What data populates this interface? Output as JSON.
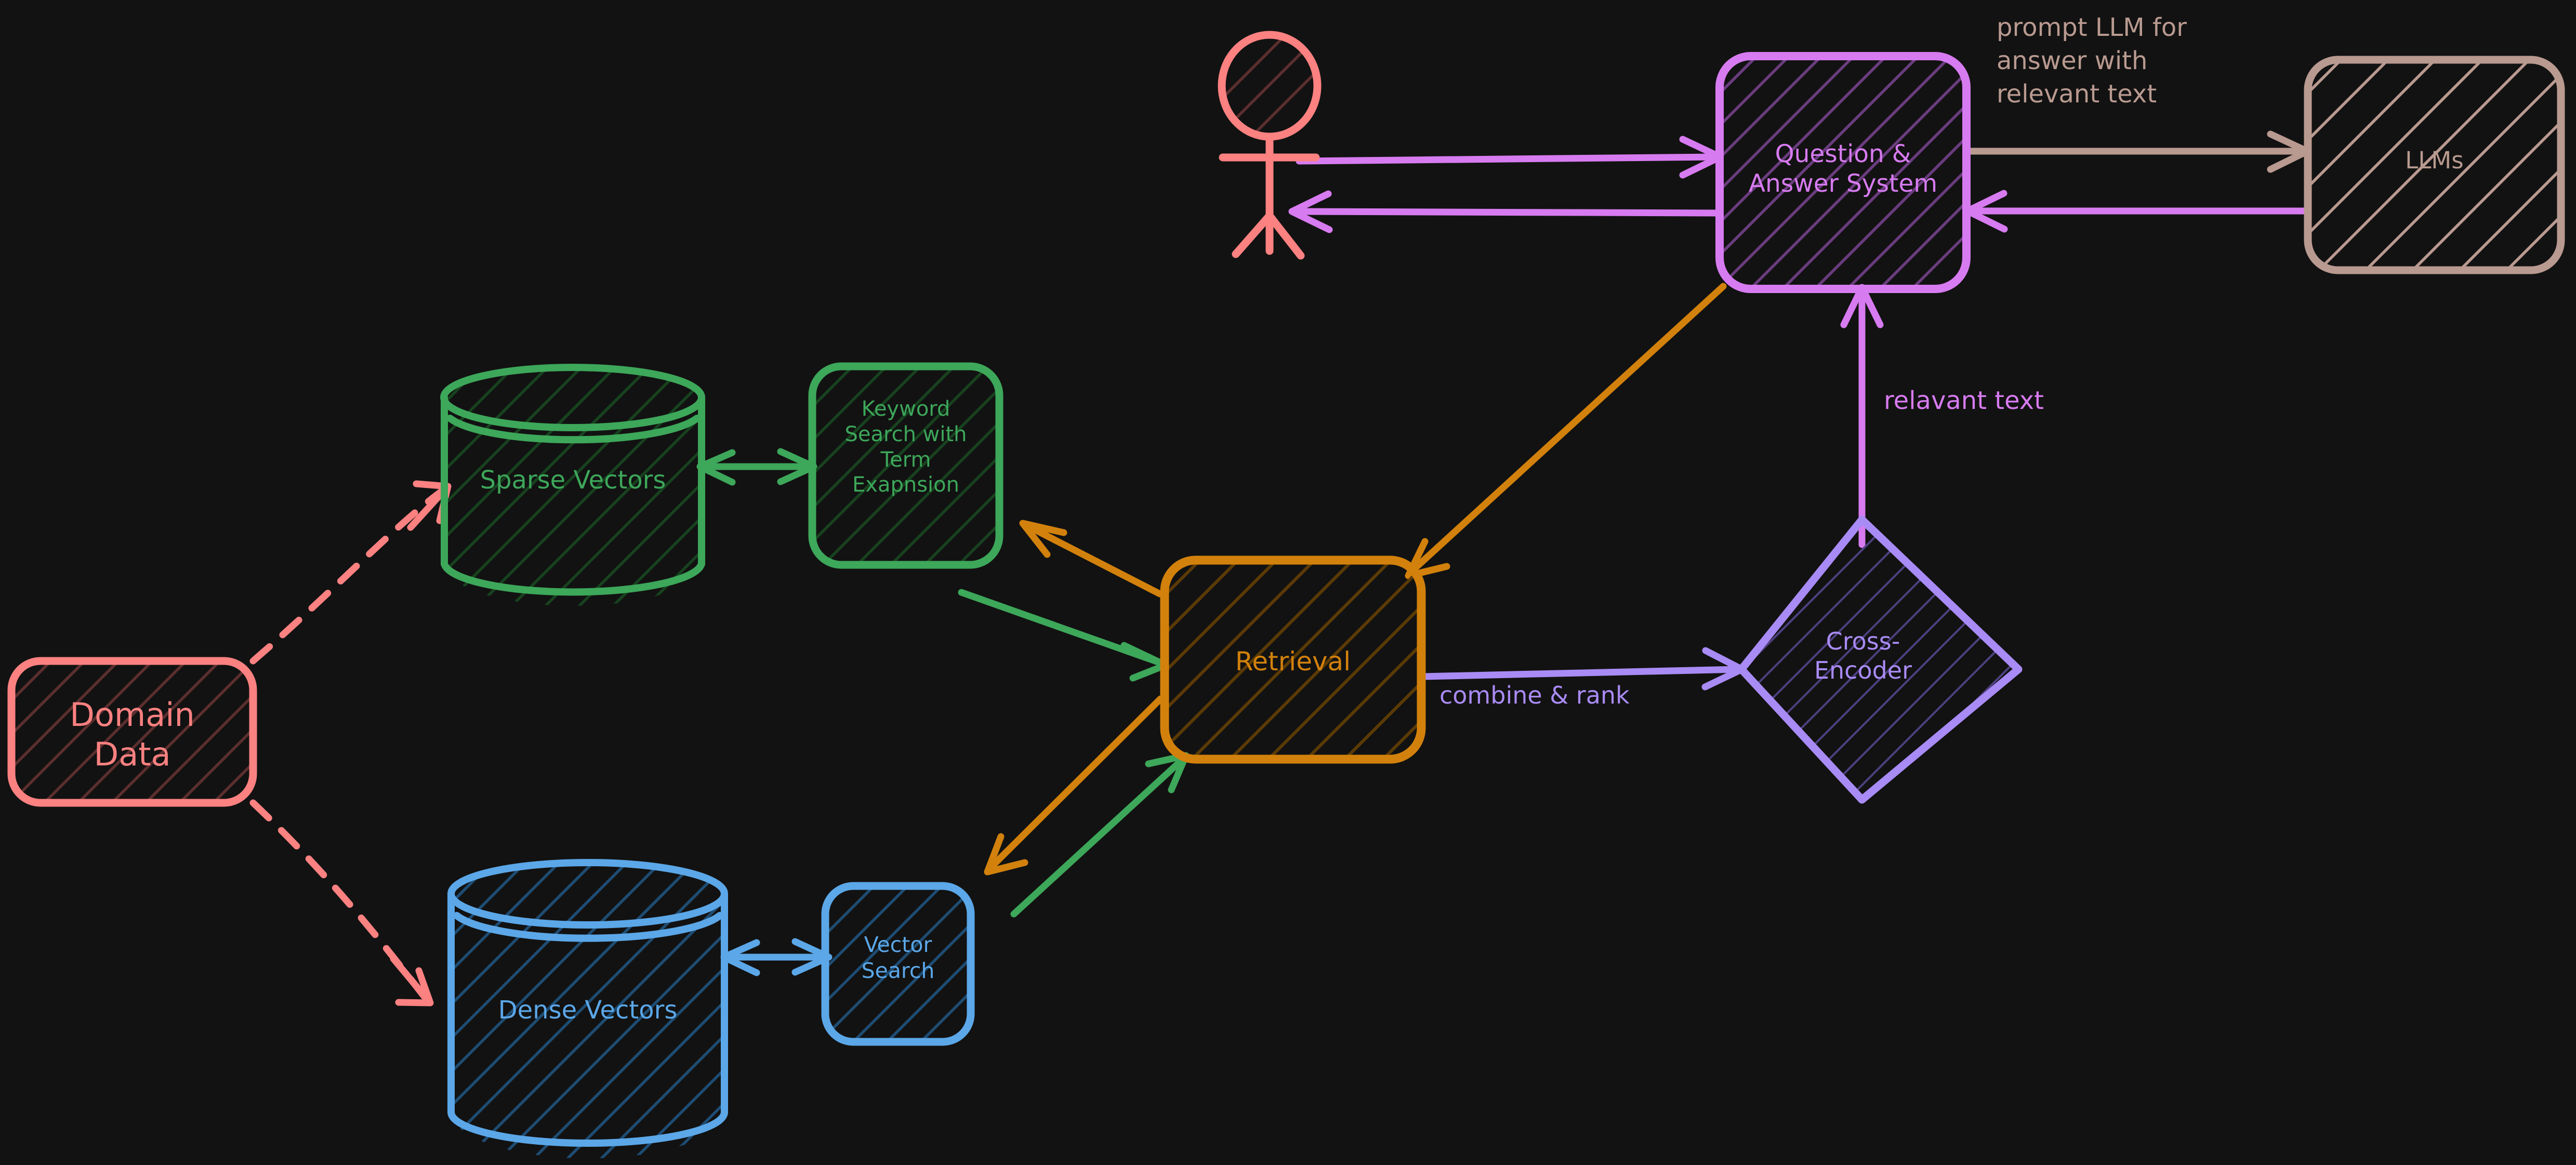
{
  "diagram": {
    "title": "Hybrid Retrieval Augmented Question Answering Architecture",
    "style": "hand-drawn sketch, dark background, hatched fills",
    "background_color": "#121212"
  },
  "colors": {
    "salmon": "#FC8181",
    "salmon_hatch": "#5C2E2E",
    "green": "#3DA75A",
    "green_hatch": "#17421F",
    "blue": "#5BA7E8",
    "blue_hatch": "#1E4C72",
    "orange": "#D2810C",
    "orange_hatch": "#5C3A05",
    "orchid": "#D77BF0",
    "orchid_hatch": "#6A3C7E",
    "lavender": "#A98BF5",
    "lavender_hatch": "#4D4080",
    "tan": "#B99A90",
    "tan_hatch": "#B99A90"
  },
  "nodes": [
    {
      "id": "actor",
      "label": "",
      "shape": "stick-figure",
      "color_key": "salmon"
    },
    {
      "id": "domain-data",
      "label": "Domain\nData",
      "shape": "rounded-rect",
      "color_key": "salmon"
    },
    {
      "id": "sparse-vectors",
      "label": "Sparse Vectors",
      "shape": "cylinder",
      "color_key": "green"
    },
    {
      "id": "dense-vectors",
      "label": "Dense Vectors",
      "shape": "cylinder",
      "color_key": "blue"
    },
    {
      "id": "keyword-search",
      "label": "Keyword\nSearch with\nTerm\nExapnsion",
      "shape": "rounded-rect",
      "color_key": "green"
    },
    {
      "id": "vector-search",
      "label": "Vector\nSearch",
      "shape": "rounded-rect",
      "color_key": "blue"
    },
    {
      "id": "retrieval",
      "label": "Retrieval",
      "shape": "rounded-rect",
      "color_key": "orange"
    },
    {
      "id": "cross-encoder",
      "label": "Cross-\nEncoder",
      "shape": "diamond",
      "color_key": "lavender"
    },
    {
      "id": "qa-system",
      "label": "Question &\nAnswer System",
      "shape": "rounded-rect",
      "color_key": "orchid"
    },
    {
      "id": "llms",
      "label": "LLMs",
      "shape": "rounded-rect",
      "color_key": "tan"
    }
  ],
  "edges": [
    {
      "id": "domain-to-sparse",
      "from": "domain-data",
      "to": "sparse-vectors",
      "label": "",
      "style": "dashed",
      "color_key": "salmon",
      "arrows": "end"
    },
    {
      "id": "domain-to-dense",
      "from": "domain-data",
      "to": "dense-vectors",
      "label": "",
      "style": "dashed",
      "color_key": "salmon",
      "arrows": "end"
    },
    {
      "id": "sparse-to-keyword",
      "from": "sparse-vectors",
      "to": "keyword-search",
      "label": "",
      "style": "solid",
      "color_key": "green",
      "arrows": "both"
    },
    {
      "id": "dense-to-vectorsearch",
      "from": "dense-vectors",
      "to": "vector-search",
      "label": "",
      "style": "solid",
      "color_key": "blue",
      "arrows": "both"
    },
    {
      "id": "keyword-to-retrieval",
      "from": "keyword-search",
      "to": "retrieval",
      "label": "",
      "style": "solid",
      "color_key": "green",
      "arrows": "end"
    },
    {
      "id": "vectorsearch-to-retrieval",
      "from": "vector-search",
      "to": "retrieval",
      "label": "",
      "style": "solid",
      "color_key": "green",
      "arrows": "end"
    },
    {
      "id": "retrieval-to-keyword",
      "from": "retrieval",
      "to": "keyword-search",
      "label": "",
      "style": "solid",
      "color_key": "orange",
      "arrows": "end"
    },
    {
      "id": "retrieval-to-vectorsearch",
      "from": "retrieval",
      "to": "vector-search",
      "label": "",
      "style": "solid",
      "color_key": "orange",
      "arrows": "end"
    },
    {
      "id": "retrieval-to-crossencoder",
      "from": "retrieval",
      "to": "cross-encoder",
      "label": "combine & rank",
      "style": "solid",
      "color_key": "lavender",
      "arrows": "end"
    },
    {
      "id": "crossencoder-to-qa",
      "from": "cross-encoder",
      "to": "qa-system",
      "label": "relavant text",
      "style": "solid",
      "color_key": "orchid",
      "arrows": "end"
    },
    {
      "id": "qa-to-retrieval",
      "from": "qa-system",
      "to": "retrieval",
      "label": "",
      "style": "solid",
      "color_key": "orange",
      "arrows": "end"
    },
    {
      "id": "actor-to-qa",
      "from": "actor",
      "to": "qa-system",
      "label": "",
      "style": "solid",
      "color_key": "orchid",
      "arrows": "end"
    },
    {
      "id": "qa-to-actor",
      "from": "qa-system",
      "to": "actor",
      "label": "",
      "style": "solid",
      "color_key": "orchid",
      "arrows": "end"
    },
    {
      "id": "qa-to-llms",
      "from": "qa-system",
      "to": "llms",
      "label": "prompt LLM for\nanswer with\nrelevant text",
      "style": "solid",
      "color_key": "tan",
      "arrows": "end"
    },
    {
      "id": "llms-to-qa",
      "from": "llms",
      "to": "qa-system",
      "label": "",
      "style": "solid",
      "color_key": "orchid",
      "arrows": "end"
    }
  ],
  "labels": {
    "domain_data": "Domain\nData",
    "sparse_vectors": "Sparse Vectors",
    "dense_vectors": "Dense Vectors",
    "keyword_search": "Keyword\nSearch with\nTerm\nExapnsion",
    "vector_search": "Vector\nSearch",
    "retrieval": "Retrieval",
    "cross_encoder": "Cross-\nEncoder",
    "qa_system": "Question &\nAnswer System",
    "llms": "LLMs",
    "combine_and_rank": "combine & rank",
    "relavant_text": "relavant text",
    "prompt_llm": "prompt LLM for\nanswer with\nrelevant text"
  }
}
